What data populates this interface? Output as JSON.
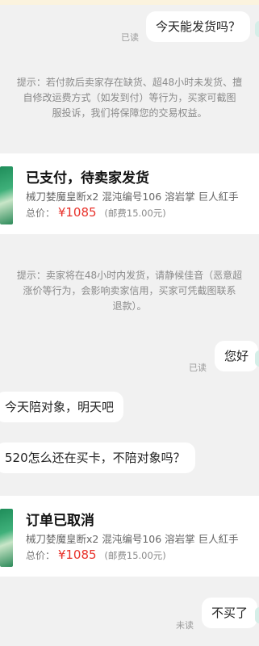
{
  "chat": {
    "msg1": {
      "text": "今天能发货吗？",
      "status": "已读"
    },
    "notice1": {
      "lines": [
        "提示：若付款后卖家存在缺货、超48小时未发货、擅",
        "自修改运费方式（如发到付）等行为，买家可截图",
        "服投诉，我们将保障您的交易权益。"
      ]
    },
    "order1": {
      "title": "已支付，待卖家发货",
      "desc": "械刀婪魔皇断x2 混沌编号106 溶岩掌 巨人紅手",
      "price_label": "总价：",
      "price": "¥1085",
      "shipping": "(邮费15.00元)"
    },
    "notice2": {
      "lines": [
        "提示：卖家将在48小时内发货，请静候佳音（恶意超",
        "涨价等行为，会影响卖家信用，买家可凭截图联系",
        "退款）。"
      ]
    },
    "msg2": {
      "text": "您好",
      "status": "已读"
    },
    "msg3": {
      "text": "今天陪对象，明天吧"
    },
    "msg4": {
      "text": "520怎么还在买卡，不陪对象吗？"
    },
    "order2": {
      "title": "订单已取消",
      "desc": "械刀婪魔皇断x2 混沌编号106 溶岩掌 巨人紅手",
      "price_label": "总价：",
      "price": "¥1085",
      "shipping": "(邮费15.00元)"
    },
    "msg5": {
      "text": "不买了",
      "status": "未读"
    }
  }
}
